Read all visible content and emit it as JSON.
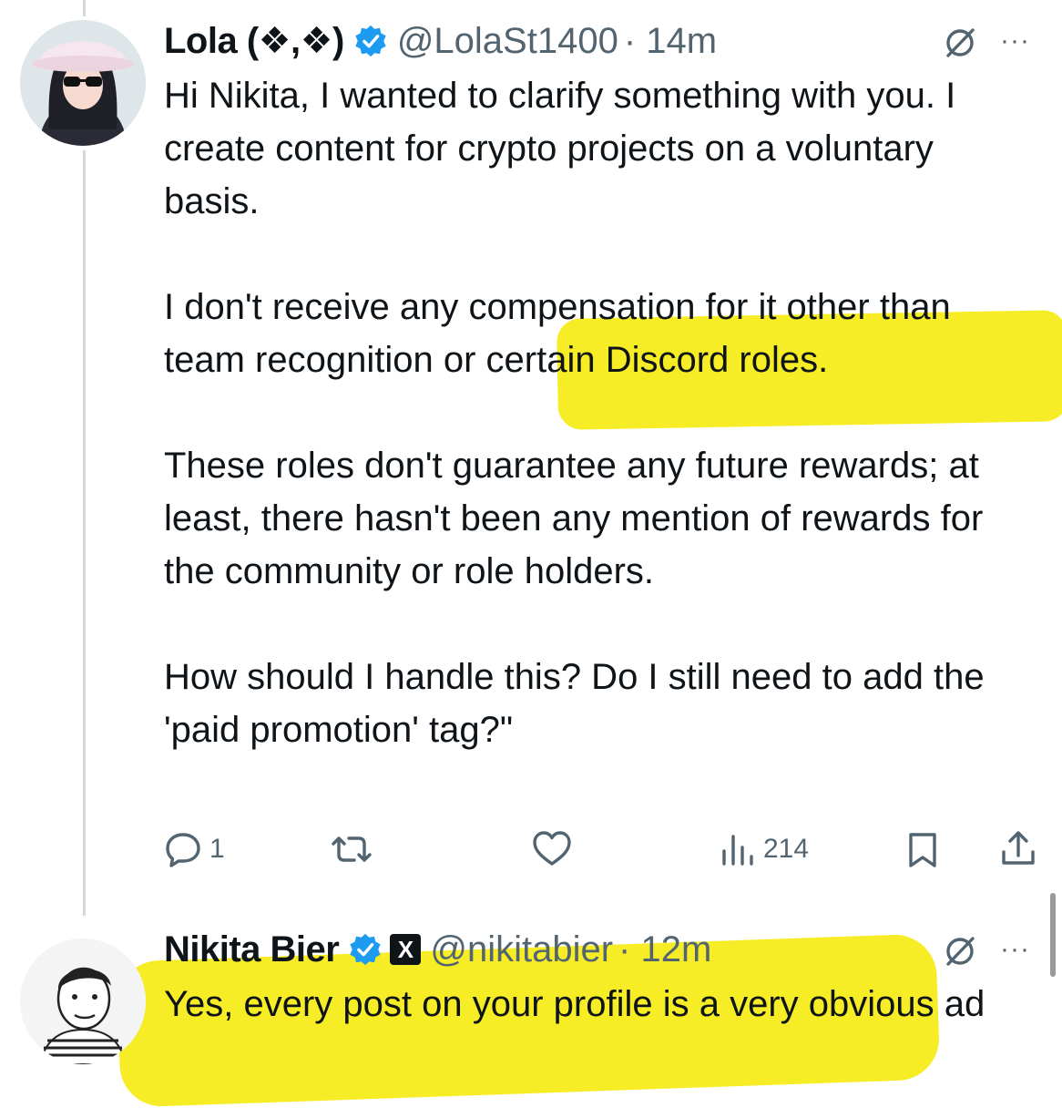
{
  "tweets": [
    {
      "name": "Lola (❖,❖)",
      "handle": "@LolaSt1400",
      "time": "· 14m",
      "verified": true,
      "text": "Hi Nikita, I wanted to clarify something with you. I create content for crypto projects on a voluntary basis.\n\nI don't receive any compensation for it other than team recognition or certain Discord roles.\n\nThese roles don't guarantee any future rewards; at least, there hasn't been any mention of rewards for the community or role holders.\n\nHow should I handle this? Do I still need to add the 'paid promotion' tag?\"",
      "actions": {
        "reply_count": "1",
        "retweet_count": "",
        "like_count": "",
        "views_count": "214"
      }
    },
    {
      "name": "Nikita Bier",
      "handle": "@nikitabier",
      "time": "· 12m",
      "verified": true,
      "affiliate_badge": "X",
      "text": "Yes, every post on your profile is a very obvious ad"
    }
  ],
  "icons": {
    "verified": "verified-badge-icon",
    "grok": "grok-icon",
    "more": "more-icon",
    "reply": "reply-icon",
    "retweet": "retweet-icon",
    "like": "heart-icon",
    "views": "views-icon",
    "bookmark": "bookmark-icon",
    "share": "share-icon"
  },
  "more_glyph": "···",
  "colors": {
    "text": "#0f1419",
    "secondary": "#536471",
    "verified": "#1d9bf0",
    "highlight": "#f6ea00",
    "thread_line": "#cfd9de"
  }
}
